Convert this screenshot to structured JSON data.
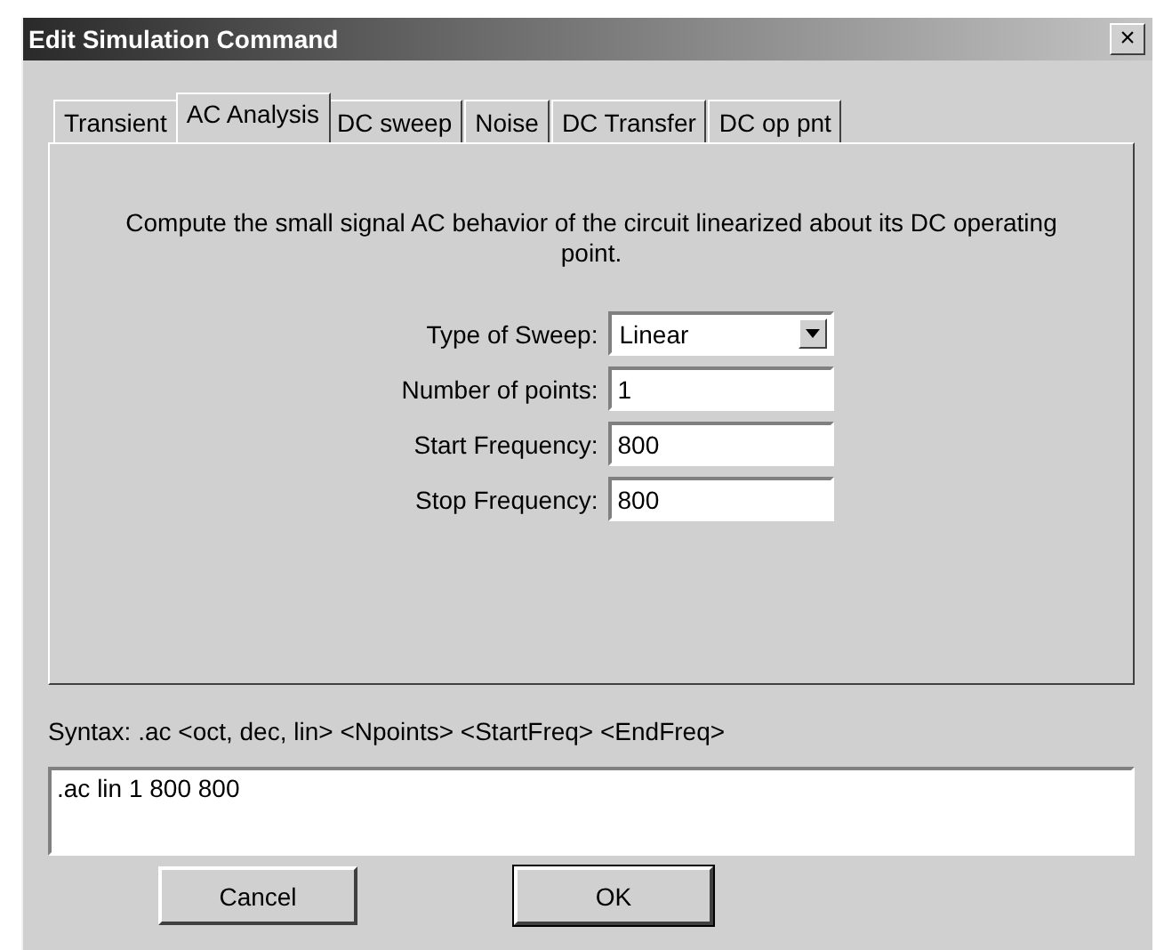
{
  "window": {
    "title": "Edit Simulation Command",
    "close": "×"
  },
  "tabs": [
    {
      "label": "Transient",
      "selected": false
    },
    {
      "label": "AC Analysis",
      "selected": true
    },
    {
      "label": "DC sweep",
      "selected": false
    },
    {
      "label": "Noise",
      "selected": false
    },
    {
      "label": "DC Transfer",
      "selected": false
    },
    {
      "label": "DC op pnt",
      "selected": false
    }
  ],
  "description": "Compute the small signal AC behavior of the circuit linearized about its DC operating point.",
  "fields": [
    {
      "kind": "dropdown",
      "label": "Type of Sweep:",
      "value": "Linear"
    },
    {
      "kind": "text",
      "label": "Number of points:",
      "value": "1"
    },
    {
      "kind": "text",
      "label": "Start Frequency:",
      "value": "800"
    },
    {
      "kind": "text",
      "label": "Stop Frequency:",
      "value": "800"
    }
  ],
  "syntax": "Syntax:  .ac <oct, dec, lin> <Npoints> <StartFreq> <EndFreq>",
  "command": ".ac lin 1 800 800",
  "buttons": [
    {
      "label": "Cancel",
      "default": false
    },
    {
      "label": "OK",
      "default": true
    }
  ]
}
